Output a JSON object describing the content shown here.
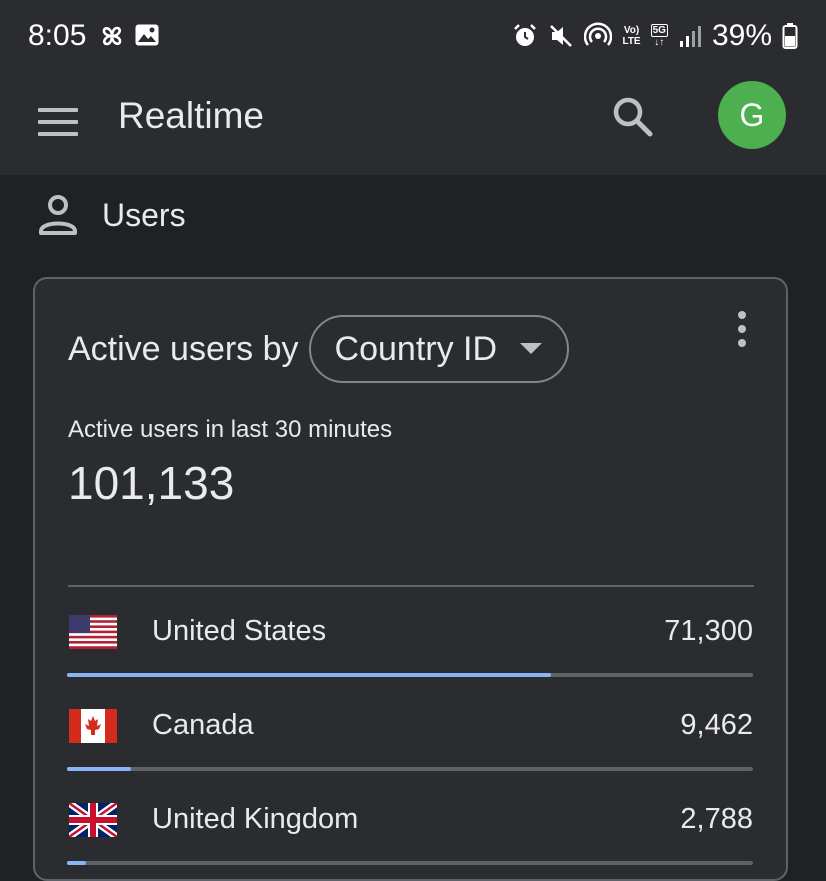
{
  "status_bar": {
    "time": "8:05",
    "battery": "39%",
    "network_lte": "LTE",
    "network_5g": "5G"
  },
  "app_bar": {
    "title": "Realtime",
    "avatar_initial": "G",
    "avatar_color": "#4caf50"
  },
  "section": {
    "title": "Users"
  },
  "card": {
    "heading_prefix": "Active users by",
    "dimension_selected": "Country ID",
    "metric_label": "Active users in last 30 minutes",
    "metric_value": "101,133",
    "accent_color": "#8ab4f8",
    "rows": [
      {
        "name": "United States",
        "value": "71,300",
        "share": 0.705,
        "flag": "us-flag"
      },
      {
        "name": "Canada",
        "value": "9,462",
        "share": 0.094,
        "flag": "canada-flag"
      },
      {
        "name": "United Kingdom",
        "value": "2,788",
        "share": 0.028,
        "flag": "uk-flag"
      }
    ]
  }
}
